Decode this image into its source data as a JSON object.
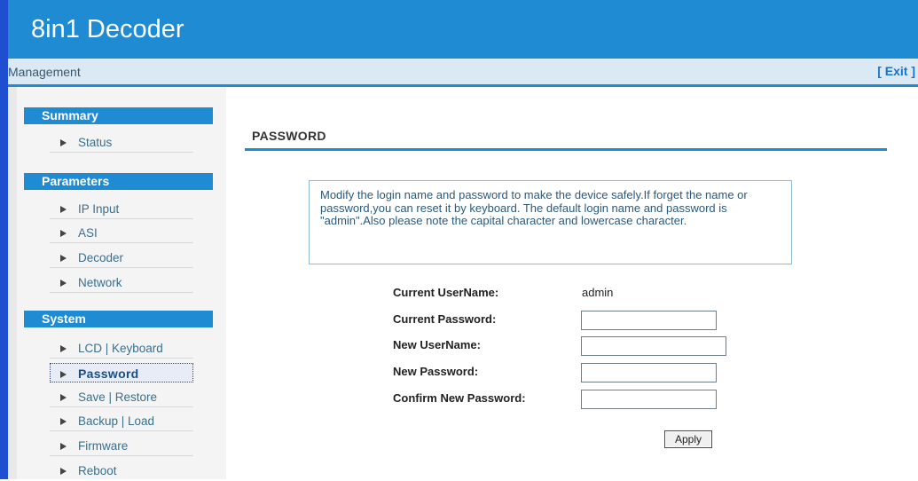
{
  "header": {
    "title": "8in1 Decoder"
  },
  "management_bar": {
    "label": "Management",
    "exit_label": "[ Exit ]"
  },
  "sidebar": {
    "sections": [
      {
        "title": "Summary",
        "items": [
          {
            "label": "Status"
          }
        ]
      },
      {
        "title": "Parameters",
        "items": [
          {
            "label": "IP Input"
          },
          {
            "label": "ASI"
          },
          {
            "label": "Decoder"
          },
          {
            "label": "Network"
          }
        ]
      },
      {
        "title": "System",
        "items": [
          {
            "label": "LCD | Keyboard"
          },
          {
            "label": "Password",
            "active": true
          },
          {
            "label": "Save | Restore"
          },
          {
            "label": "Backup | Load"
          },
          {
            "label": "Firmware"
          },
          {
            "label": "Reboot"
          }
        ]
      }
    ]
  },
  "main": {
    "title": "PASSWORD",
    "info_text": "Modify the login name and password to make the device safely.If forget the name or password,you can reset it by keyboard. The default login name and password is \"admin\".Also please note the capital character and lowercase character.",
    "form": {
      "current_username_label": "Current UserName:",
      "current_username_value": "admin",
      "current_password_label": "Current Password:",
      "current_password_value": "",
      "new_username_label": "New UserName:",
      "new_username_value": "",
      "new_password_label": "New Password:",
      "new_password_value": "",
      "confirm_password_label": "Confirm New Password:",
      "confirm_password_value": "",
      "apply_label": "Apply"
    }
  },
  "colors": {
    "header_blue": "#1f8bd2",
    "left_edge_blue": "#1e4fd0",
    "link_blue": "#3a6f8e"
  }
}
